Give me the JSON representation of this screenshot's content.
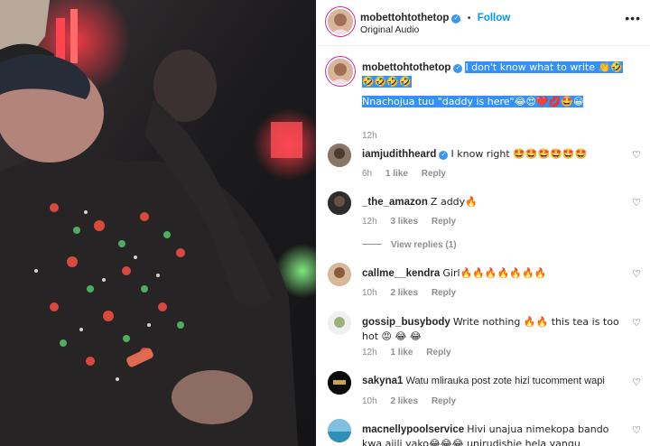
{
  "header": {
    "username": "mobettohtothetop",
    "verified_mark": "✓",
    "separator": "•",
    "follow_label": "Follow",
    "audio_label": "Original Audio",
    "more_icon": "•••"
  },
  "caption": {
    "username": "mobettohtothetop",
    "verified_mark": "✓",
    "line1": "I don't know what to write 👏🤣🤣🤣🤣🤣",
    "line2": "Nnachojua tuu \"daddy is here\"😂😍❤️💋🤩😀",
    "time": "12h"
  },
  "comments": [
    {
      "username": "iamjudithheard",
      "verified": true,
      "text": "I know right 🤩🤩🤩🤩🤩🤩",
      "time": "6h",
      "likes": "1 like",
      "reply": "Reply"
    },
    {
      "username": "_the_amazon",
      "verified": false,
      "text": "Z addy🔥",
      "time": "12h",
      "likes": "3 likes",
      "reply": "Reply",
      "view_replies": "View replies (1)"
    },
    {
      "username": "callme__kendra",
      "verified": false,
      "text": "Girl🔥🔥🔥🔥🔥🔥🔥",
      "time": "10h",
      "likes": "2 likes",
      "reply": "Reply"
    },
    {
      "username": "gossip_busybody",
      "verified": false,
      "text": "Write nothing 🔥🔥 this tea is too hot 😡 😂 😂",
      "time": "12h",
      "likes": "1 like",
      "reply": "Reply"
    },
    {
      "username": "sakyna1",
      "verified": false,
      "text": "Watu mlirauka post zote hizi tucomment wapi",
      "time": "10h",
      "likes": "2 likes",
      "reply": "Reply"
    },
    {
      "username": "macnellypoolservice",
      "verified": false,
      "text": "Hivi unajua nimekopa bando kwa ajili yako😂😂😂 unirudishie hela yangu",
      "time": "",
      "likes": "",
      "reply": ""
    }
  ],
  "colors": {
    "accent": "#0095f6",
    "verified": "#3897f0",
    "selection": "#3390ff",
    "muted": "#8e8e8e"
  }
}
